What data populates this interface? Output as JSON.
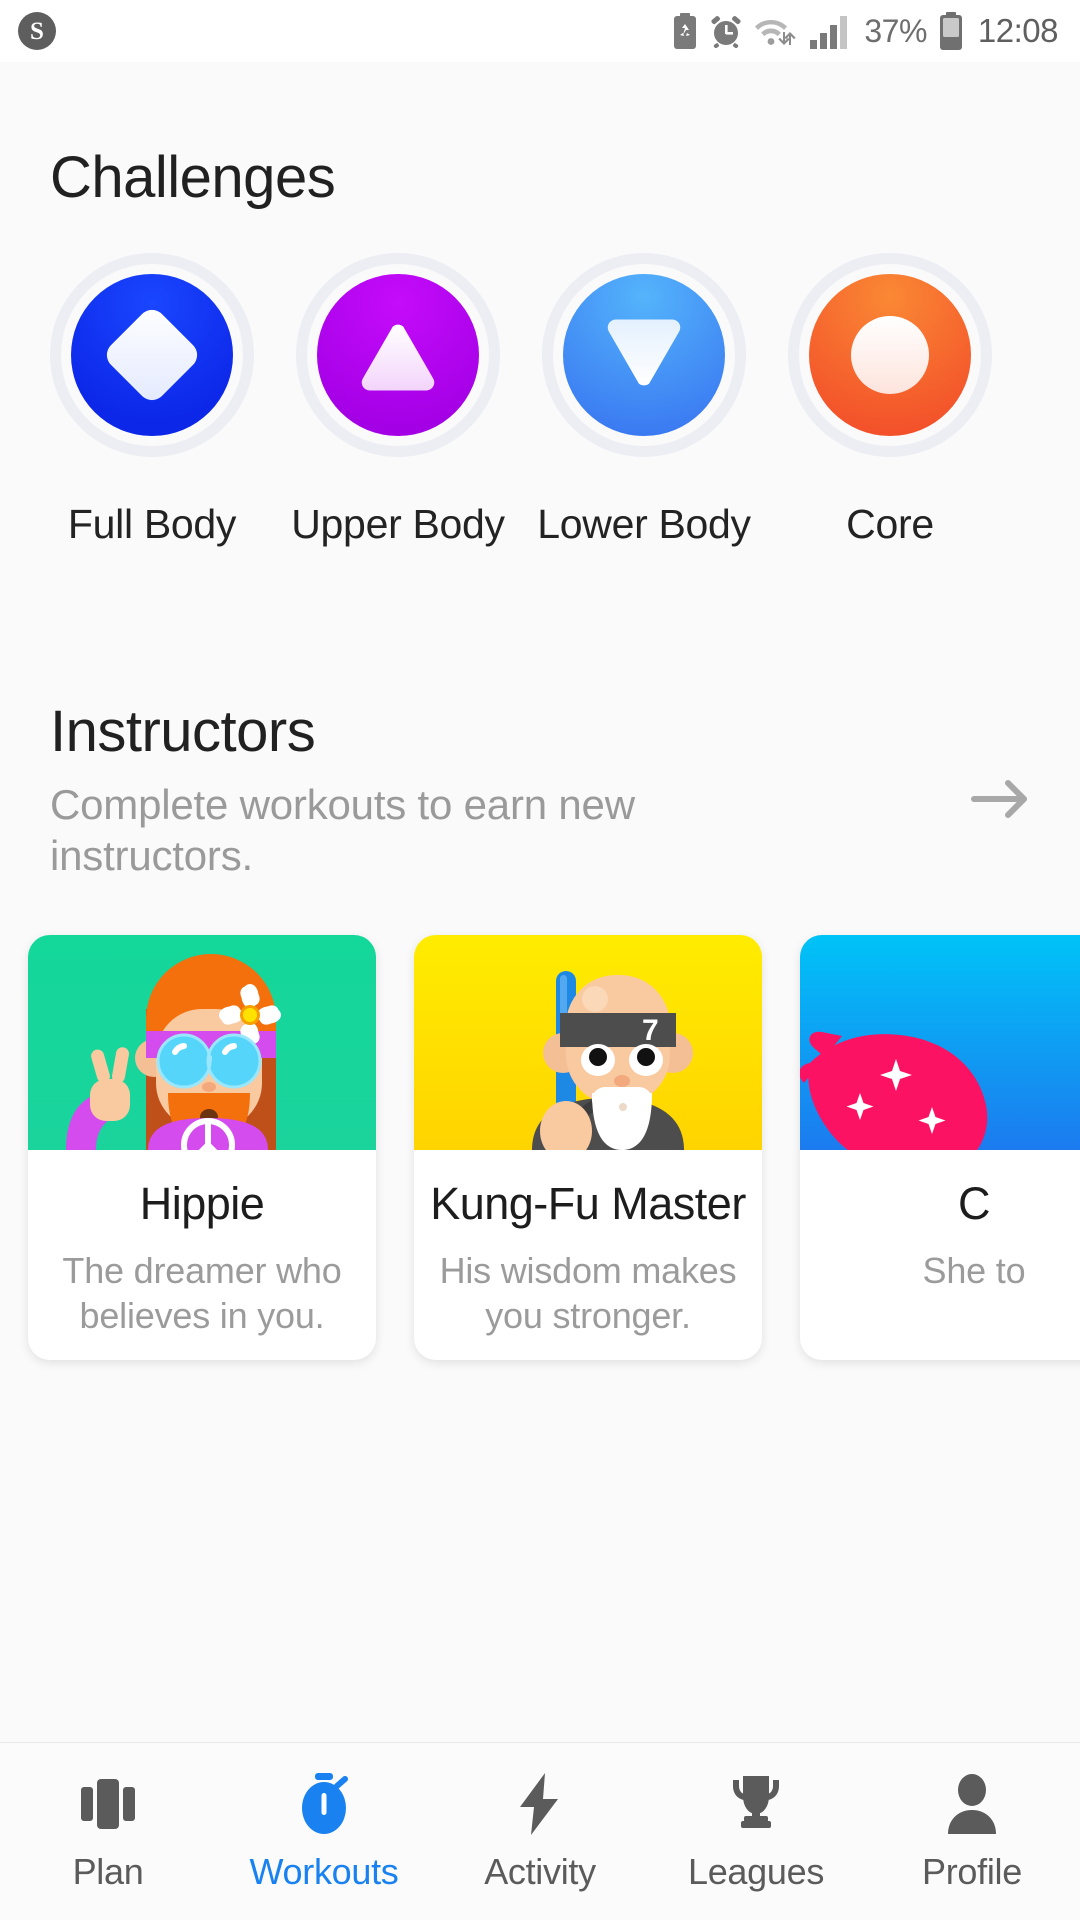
{
  "status_bar": {
    "app_logo_letter": "S",
    "icons": [
      "battery-saver-icon",
      "alarm-clock-icon",
      "wifi-icon",
      "cellular-signal-icon"
    ],
    "battery_percent": "37%",
    "time": "12:08"
  },
  "challenges": {
    "title": "Challenges",
    "items": [
      {
        "label": "Full Body",
        "icon": "diamond-glyph",
        "color": "#0C3BF5",
        "color2": "#1433EF"
      },
      {
        "label": "Upper Body",
        "icon": "triangle-up-glyph",
        "color": "#B404F0",
        "color2": "#A800E8"
      },
      {
        "label": "Lower Body",
        "icon": "triangle-down-glyph",
        "color": "#46A6F8",
        "color2": "#3D7FF2"
      },
      {
        "label": "Core",
        "icon": "circle-glyph",
        "color": "#F9812F",
        "color2": "#F45C2C"
      }
    ]
  },
  "instructors": {
    "title": "Instructors",
    "subtitle": "Complete workouts to earn new instructors.",
    "see_all_icon": "arrow-right-icon",
    "cards": [
      {
        "name": "Hippie",
        "description": "The dreamer who believes in you.",
        "art_bg": "#19D79B",
        "art": "hippie-avatar"
      },
      {
        "name": "Kung-Fu Master",
        "description": "His wisdom makes you stronger.",
        "art_bg": "#FFE100",
        "art": "kungfu-master-avatar"
      },
      {
        "name": "C",
        "description": "She\nto",
        "art_bg": "#00B4F0",
        "art": "punk-avatar"
      }
    ]
  },
  "bottom_nav": {
    "active_color": "#1A82F0",
    "items": [
      {
        "label": "Plan",
        "icon": "cards-icon",
        "active": false
      },
      {
        "label": "Workouts",
        "icon": "stopwatch-icon",
        "active": true
      },
      {
        "label": "Activity",
        "icon": "lightning-icon",
        "active": false
      },
      {
        "label": "Leagues",
        "icon": "trophy-icon",
        "active": false
      },
      {
        "label": "Profile",
        "icon": "person-icon",
        "active": false
      }
    ]
  }
}
